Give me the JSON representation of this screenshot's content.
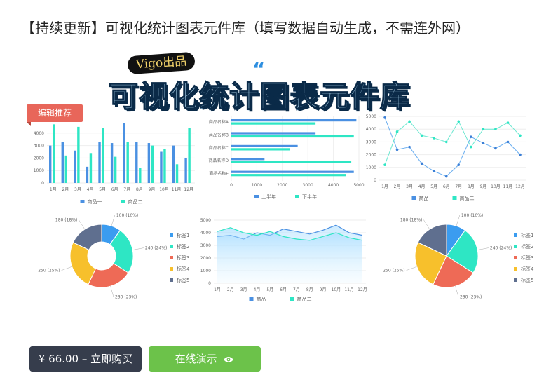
{
  "page": {
    "title": "【持续更新】可视化统计图表元件库（填写数据自动生成，不需连外网）",
    "hero_badge": "Vigo出品",
    "hero_title": "可视化统计图表元件库",
    "ribbon": "编辑推荐"
  },
  "actions": {
    "buy_label": "¥ 66.00 – 立即购买",
    "demo_label": "在线演示",
    "demo_icon": "eye-icon"
  },
  "colors": {
    "accent_blue": "#4a90e2",
    "accent_teal": "#2ee6c4",
    "buy_bg": "#363d4c",
    "demo_bg": "#6cc24a",
    "ribbon_bg": "#e8665a"
  },
  "chart_data": [
    {
      "type": "bar",
      "categories": [
        "1月",
        "2月",
        "3月",
        "4月",
        "5月",
        "6月",
        "7月",
        "8月",
        "9月",
        "10月",
        "11月",
        "12月"
      ],
      "series": [
        {
          "name": "商品一",
          "values": [
            3000,
            3300,
            2600,
            1300,
            3300,
            3200,
            4800,
            3300,
            3200,
            2500,
            3000,
            2000
          ]
        },
        {
          "name": "商品二",
          "values": [
            4700,
            2200,
            4500,
            2400,
            4400,
            2100,
            3300,
            1200,
            3000,
            2700,
            1500,
            4400
          ]
        }
      ],
      "yticks": [
        "0",
        "1000",
        "2000",
        "3000",
        "4000"
      ],
      "ylim": [
        0,
        5000
      ],
      "legend": "bottom"
    },
    {
      "type": "bar",
      "orientation": "horizontal",
      "categories": [
        "商品名称A",
        "商品名称B",
        "商品名称C",
        "商品名称D",
        "商品名称E"
      ],
      "series": [
        {
          "name": "上半年",
          "values": [
            4900,
            3300,
            2600,
            1300,
            4800
          ]
        },
        {
          "name": "下半年",
          "values": [
            3300,
            4800,
            2300,
            4700,
            4500
          ]
        }
      ],
      "xticks": [
        "0",
        "1000",
        "2000",
        "3000",
        "4000",
        "5000"
      ],
      "xlim": [
        0,
        5000
      ],
      "legend": "bottom"
    },
    {
      "type": "line",
      "categories": [
        "1月",
        "2月",
        "3月",
        "4月",
        "5月",
        "6月",
        "7月",
        "8月",
        "9月",
        "10月",
        "11月",
        "12月"
      ],
      "series": [
        {
          "name": "商品一",
          "values": [
            4900,
            2400,
            2600,
            1300,
            700,
            300,
            1200,
            3400,
            2900,
            2500,
            3000,
            2000
          ]
        },
        {
          "name": "商品二",
          "values": [
            1200,
            3800,
            4600,
            3500,
            3300,
            3000,
            4600,
            2600,
            4000,
            4000,
            4500,
            3500
          ]
        }
      ],
      "yticks": [
        "0",
        "1000",
        "2000",
        "3000",
        "4000",
        "5000"
      ],
      "ylim": [
        0,
        5000
      ],
      "legend": "bottom"
    },
    {
      "type": "pie",
      "variant": "donut",
      "labels": [
        "标签1",
        "标签2",
        "标签3",
        "标签4",
        "标签5"
      ],
      "values": [
        100,
        240,
        230,
        250,
        180
      ],
      "slice_labels": [
        "100 (10%)",
        "240 (24%)",
        "230 (23%)",
        "250 (25%)",
        "180 (18%)"
      ],
      "colors": [
        "#3b9cf0",
        "#2ee6c4",
        "#ee6a56",
        "#f7c02c",
        "#5f6f8f"
      ],
      "legend": "right"
    },
    {
      "type": "area",
      "categories": [
        "1月",
        "2月",
        "3月",
        "4月",
        "5月",
        "6月",
        "7月",
        "8月",
        "9月",
        "10月",
        "11月",
        "12月"
      ],
      "series": [
        {
          "name": "商品一",
          "values": [
            3700,
            3800,
            3500,
            4000,
            3800,
            4300,
            4100,
            3900,
            4200,
            4600,
            4000,
            3800
          ]
        },
        {
          "name": "商品二",
          "values": [
            4100,
            4400,
            4000,
            3800,
            4100,
            3700,
            3500,
            3400,
            3700,
            4000,
            3600,
            3400
          ]
        }
      ],
      "yticks": [
        "0",
        "1000",
        "2000",
        "3000",
        "4000",
        "5000"
      ],
      "ylim": [
        0,
        5000
      ],
      "legend": "bottom"
    },
    {
      "type": "pie",
      "labels": [
        "标签1",
        "标签2",
        "标签3",
        "标签4",
        "标签5"
      ],
      "values": [
        100,
        240,
        230,
        250,
        180
      ],
      "slice_labels": [
        "100 (10%)",
        "240 (24%)",
        "230 (23%)",
        "250 (25%)",
        "180 (18%)"
      ],
      "colors": [
        "#3b9cf0",
        "#2ee6c4",
        "#ee6a56",
        "#f7c02c",
        "#5f6f8f"
      ],
      "legend": "right"
    }
  ]
}
